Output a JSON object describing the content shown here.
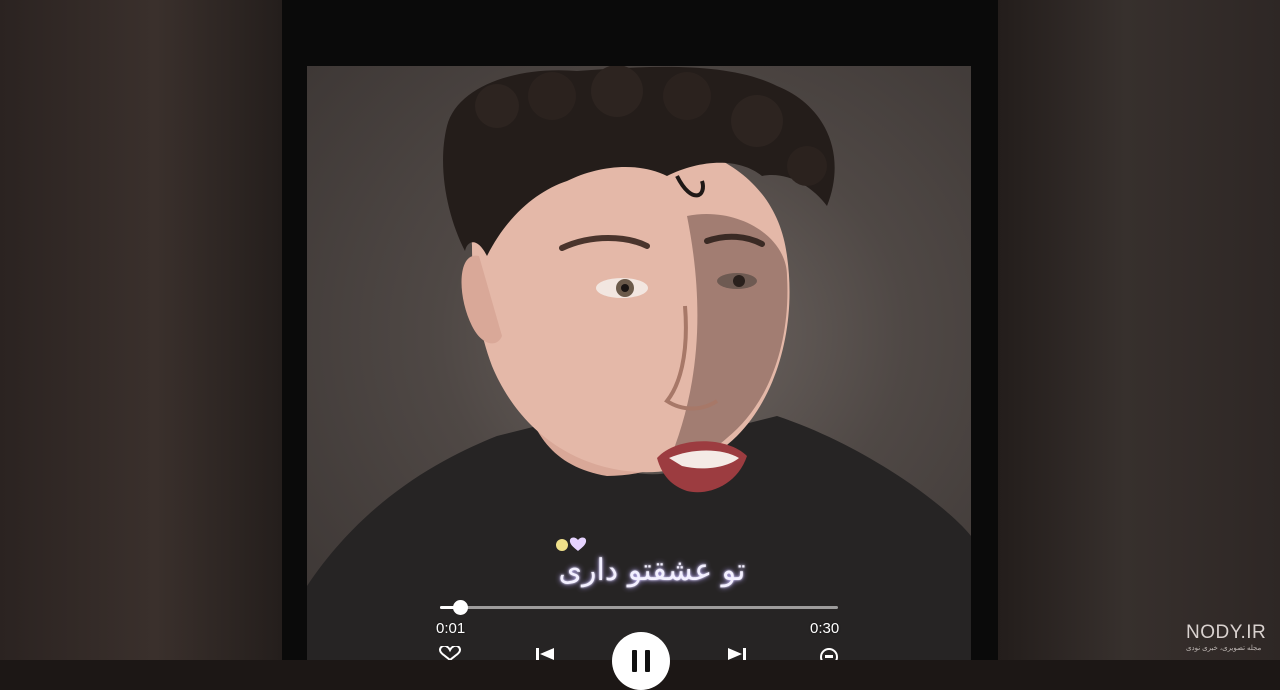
{
  "player": {
    "lyric_text": "تو عشقتو داری",
    "time_elapsed": "0:01",
    "time_total": "0:30",
    "progress": 0.05,
    "state": "playing"
  },
  "icons": {
    "like": "heart-icon",
    "previous": "skip-back-icon",
    "pause": "pause-icon",
    "next": "skip-forward-icon",
    "repeat": "repeat-icon",
    "emoji": "hearts-emoji-icon"
  },
  "watermark": {
    "title": "NODY.IR",
    "subtitle": "مجله تصویری، خبری نودی"
  },
  "colors": {
    "phone_frame": "#0a0a0a",
    "controls": "#ffffff",
    "lyric_glow": "#b9a8ff"
  }
}
